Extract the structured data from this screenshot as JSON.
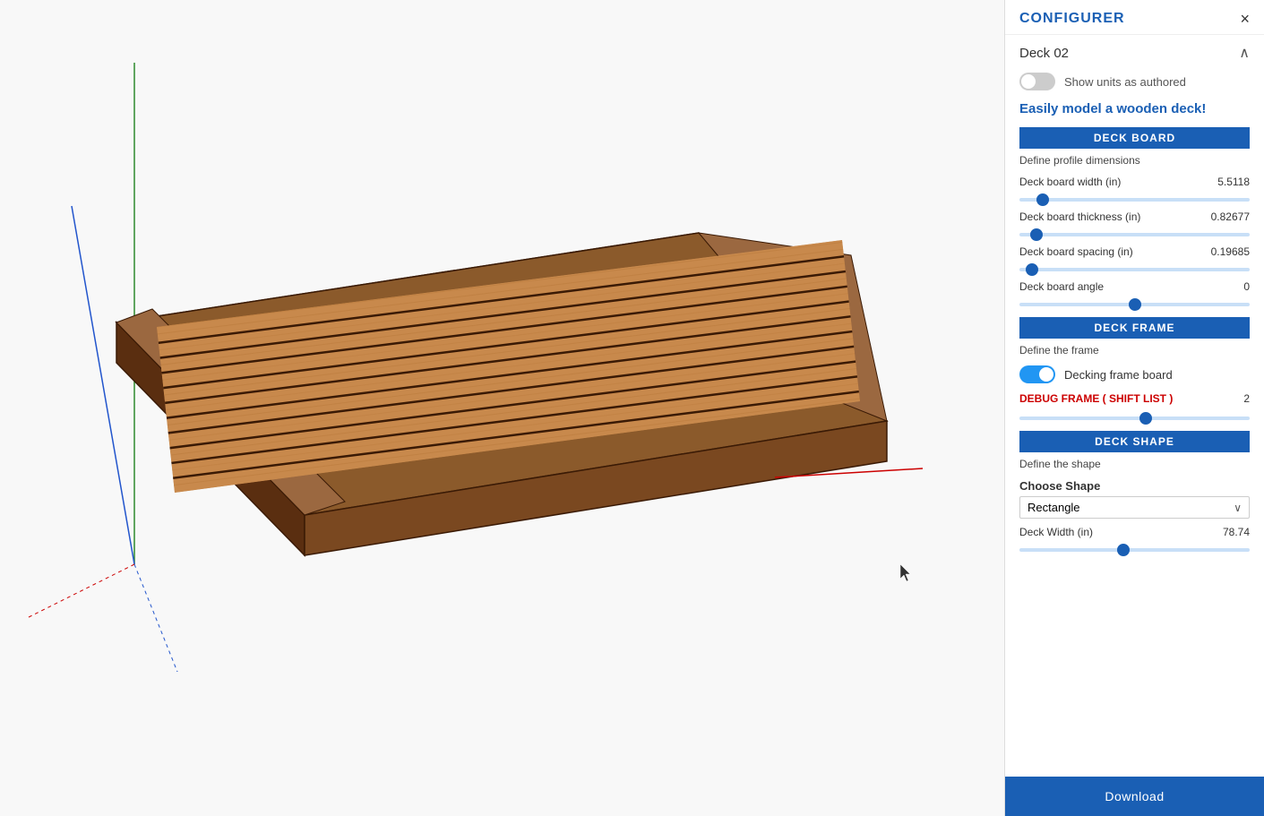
{
  "panel": {
    "title": "CONFIGURER",
    "close_label": "×",
    "deck_name": "Deck 02",
    "chevron_up": "∧",
    "toggle_units_label": "Show units as authored",
    "tagline": "Easily model a wooden deck!",
    "sections": {
      "deck_board": {
        "header": "DECK BOARD",
        "sub_label": "Define profile dimensions",
        "params": [
          {
            "label": "Deck board width (in)",
            "value": "5.5118",
            "slider_pos": 0.08
          },
          {
            "label": "Deck board thickness (in)",
            "value": "0.82677",
            "slider_pos": 0.05
          },
          {
            "label": "Deck board spacing (in)",
            "value": "0.19685",
            "slider_pos": 0.03
          },
          {
            "label": "Deck board angle",
            "value": "0",
            "slider_pos": 0.5
          }
        ]
      },
      "deck_frame": {
        "header": "DECK FRAME",
        "sub_label": "Define the frame",
        "frame_toggle_label": "Decking frame board",
        "frame_toggle_on": true,
        "debug_label": "DEBUG FRAME ( SHIFT LIST )",
        "debug_value": "2",
        "debug_slider_pos": 0.55
      },
      "deck_shape": {
        "header": "DECK SHAPE",
        "sub_label": "Define the shape",
        "choose_shape_label": "Choose Shape",
        "shape_value": "Rectangle",
        "deck_width_label": "Deck Width (in)",
        "deck_width_value": "78.74",
        "deck_width_slider_pos": 0.45
      }
    },
    "download_label": "Download"
  },
  "cursor": {
    "symbol": "⬆"
  },
  "viewport": {
    "background": "#f5f5f5"
  }
}
